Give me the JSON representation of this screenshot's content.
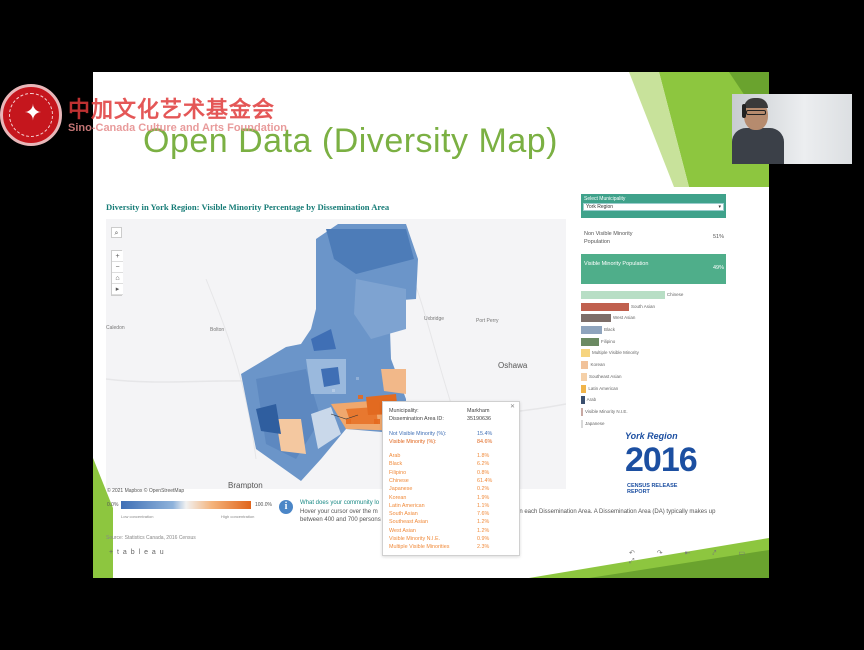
{
  "org": {
    "name_cn": "中加文化艺术基金会",
    "name_en": "Sino-Canada Culture and Arts Foundation"
  },
  "slide": {
    "title": "Open Data (Diversity Map)"
  },
  "viz": {
    "title": "Diversity in York Region: Visible Minority Percentage by Dissemination Area",
    "map_places": {
      "uxbridge": "Uxbridge",
      "port_perry": "Port Perry",
      "oshawa": "Oshawa",
      "brampton": "Brampton",
      "caledon": "Caledon",
      "bolton": "Bolton"
    },
    "copyright": "© 2021 Mapbox  © OpenStreetMap",
    "legend": {
      "min": "0.0%",
      "max": "100.0%",
      "min_label": "Low concentration",
      "max_label": "High concentration"
    },
    "info": {
      "heading": "What does your community lo",
      "line1": "Hover your cursor over the m",
      "line2": "between 400 and 700 persons",
      "line_right": "in each Dissemination Area. A Dissemination Area (DA) typically makes up"
    },
    "source": "Source: Statistics Canada, 2016 Census",
    "tableau": "+ t a b l e a u",
    "share_icons": "↶ ↷ ⇤ ⤤ ▭ ⤢"
  },
  "tooltip": {
    "close": "✕",
    "municipality_key": "Municipality:",
    "municipality_val": "Markham",
    "da_key": "Dissemination Area ID:",
    "da_val": "35190636",
    "nonvis_key": "Not Visible Minority (%):",
    "nonvis_val": "15.4%",
    "vis_key": "Visible Minority (%):",
    "vis_val": "84.6%",
    "groups": [
      {
        "k": "Arab",
        "v": "1.8%"
      },
      {
        "k": "Black",
        "v": "6.2%"
      },
      {
        "k": "Filipino",
        "v": "0.8%"
      },
      {
        "k": "Chinese",
        "v": "61.4%"
      },
      {
        "k": "Japanese",
        "v": "0.2%"
      },
      {
        "k": "Korean",
        "v": "1.9%"
      },
      {
        "k": "Latin American",
        "v": "1.1%"
      },
      {
        "k": "South Asian",
        "v": "7.6%"
      },
      {
        "k": "Southeast Asian",
        "v": "1.2%"
      },
      {
        "k": "West Asian",
        "v": "1.2%"
      },
      {
        "k": "Visible Minority N.I.E.",
        "v": "0.9%"
      },
      {
        "k": "Multiple Visible Minorities",
        "v": "2.3%"
      }
    ]
  },
  "panel": {
    "select_label": "Select Municipality",
    "selected_value": "York Region",
    "nonvis_label": "Non Visible Minority Population",
    "nonvis_pct": "51%",
    "vis_label": "Visible Minority Population",
    "vis_pct": "49%",
    "bars": [
      {
        "label": "Chinese",
        "value": 0.28,
        "color": "#b8dec5"
      },
      {
        "label": "South Asian",
        "value": 0.16,
        "color": "#c0604e"
      },
      {
        "label": "West Asian",
        "value": 0.1,
        "color": "#7d6e69"
      },
      {
        "label": "Black",
        "value": 0.07,
        "color": "#8fa4bd"
      },
      {
        "label": "Filipino",
        "value": 0.06,
        "color": "#6b8a62"
      },
      {
        "label": "Multiple Visible Minority",
        "value": 0.03,
        "color": "#f6d47e"
      },
      {
        "label": "Korean",
        "value": 0.025,
        "color": "#f1c29a"
      },
      {
        "label": "Southeast Asian",
        "value": 0.02,
        "color": "#f5d0a8"
      },
      {
        "label": "Latin American",
        "value": 0.018,
        "color": "#f0b44a"
      },
      {
        "label": "Arab",
        "value": 0.012,
        "color": "#3b4f6e"
      },
      {
        "label": "Visible Minority N.I.E.",
        "value": 0.006,
        "color": "#c8a9a3"
      },
      {
        "label": "Japanese",
        "value": 0.005,
        "color": "#d9d9d9"
      }
    ]
  },
  "yr_logo": {
    "name": "York Region",
    "year": "2016",
    "subtitle": "CENSUS RELEASE REPORT"
  },
  "colors": {
    "accent_green": "#7bb043",
    "teal": "#177c77",
    "blue_low": "#3f6fb5",
    "orange_high": "#e0651c"
  }
}
